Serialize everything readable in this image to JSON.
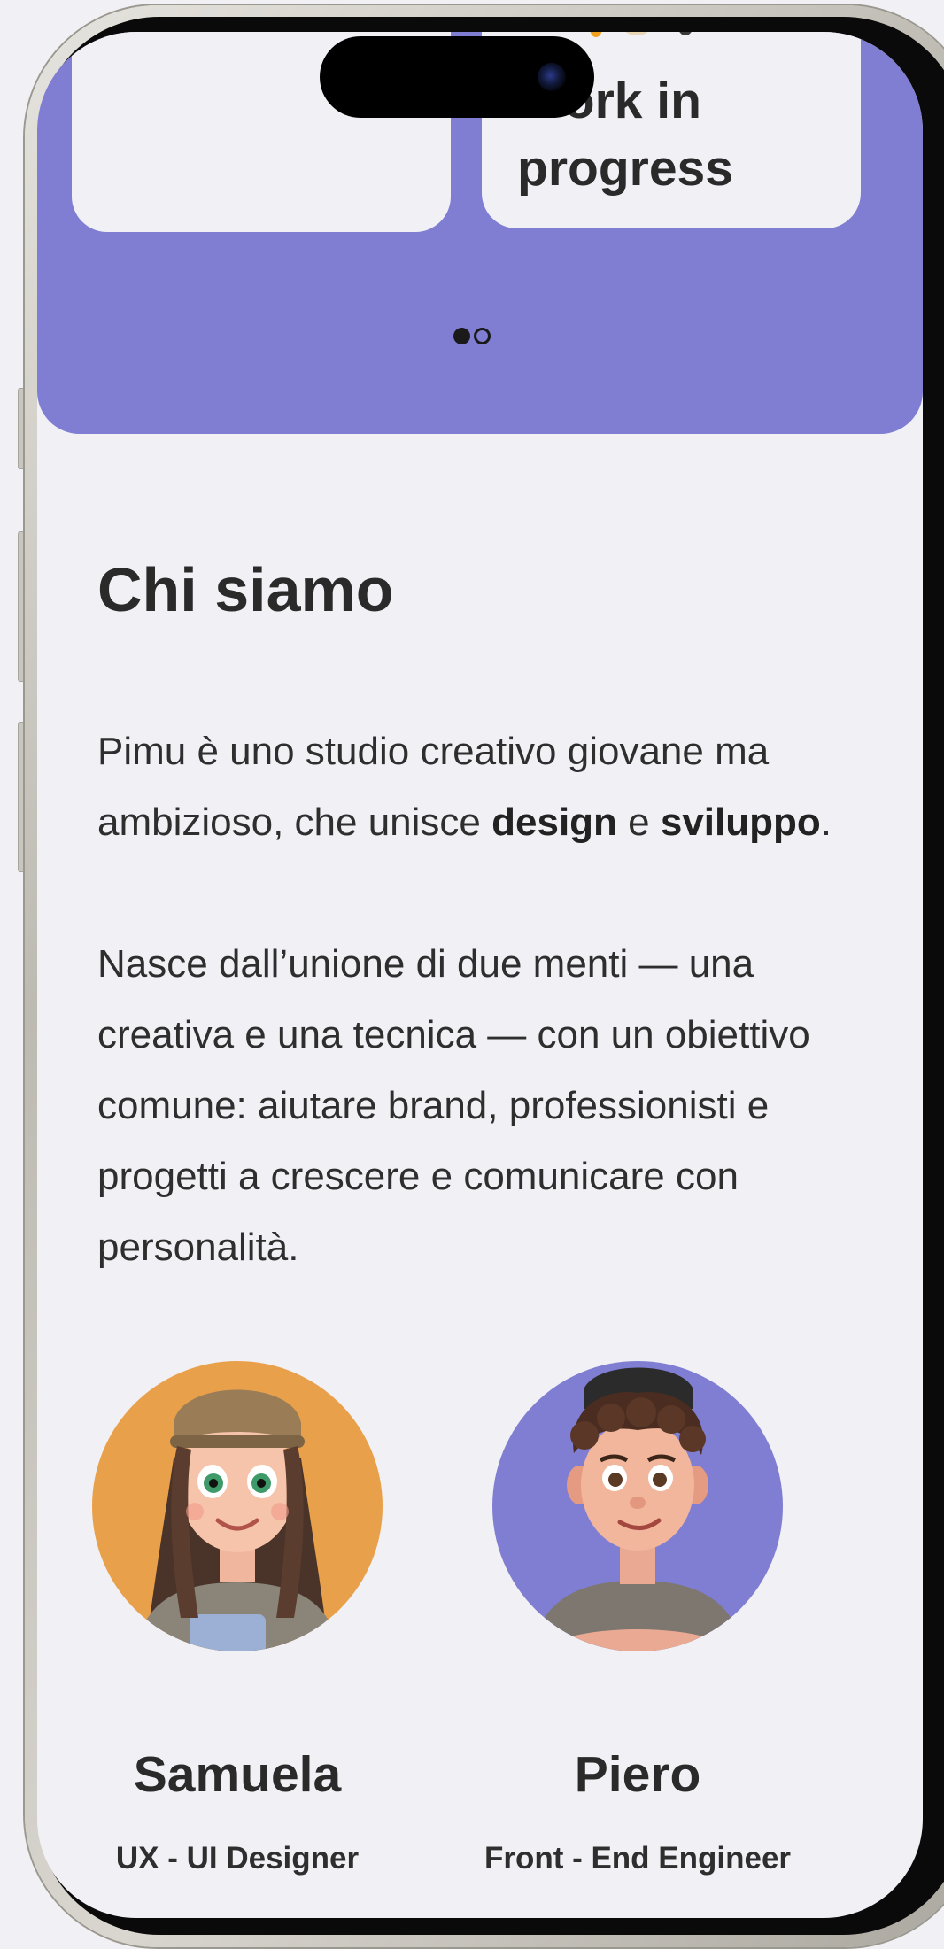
{
  "carousel": {
    "cards": [
      {
        "title": ""
      },
      {
        "title": "Work in\nprogress"
      }
    ],
    "dots": [
      {
        "active": true
      },
      {
        "active": false
      }
    ],
    "background_color": "#7f7ed2"
  },
  "about": {
    "title": "Chi siamo",
    "intro_before": "Pimu è uno studio creativo giovane ma ambizioso, che unisce ",
    "intro_bold_1": "design",
    "intro_mid": " e ",
    "intro_bold_2": "sviluppo",
    "intro_end": ".",
    "body": "Nasce dall’unione di due menti — una creativa e una tecnica — con un obiettivo comune: aiutare brand, professionisti e progetti a crescere e comunicare con personalità."
  },
  "team": [
    {
      "name": "Samuela",
      "role": "UX - UI Designer",
      "avatar_bg": "#e9a04a"
    },
    {
      "name": "Piero",
      "role": "Front - End Engineer",
      "avatar_bg": "#7f7ed2"
    }
  ]
}
